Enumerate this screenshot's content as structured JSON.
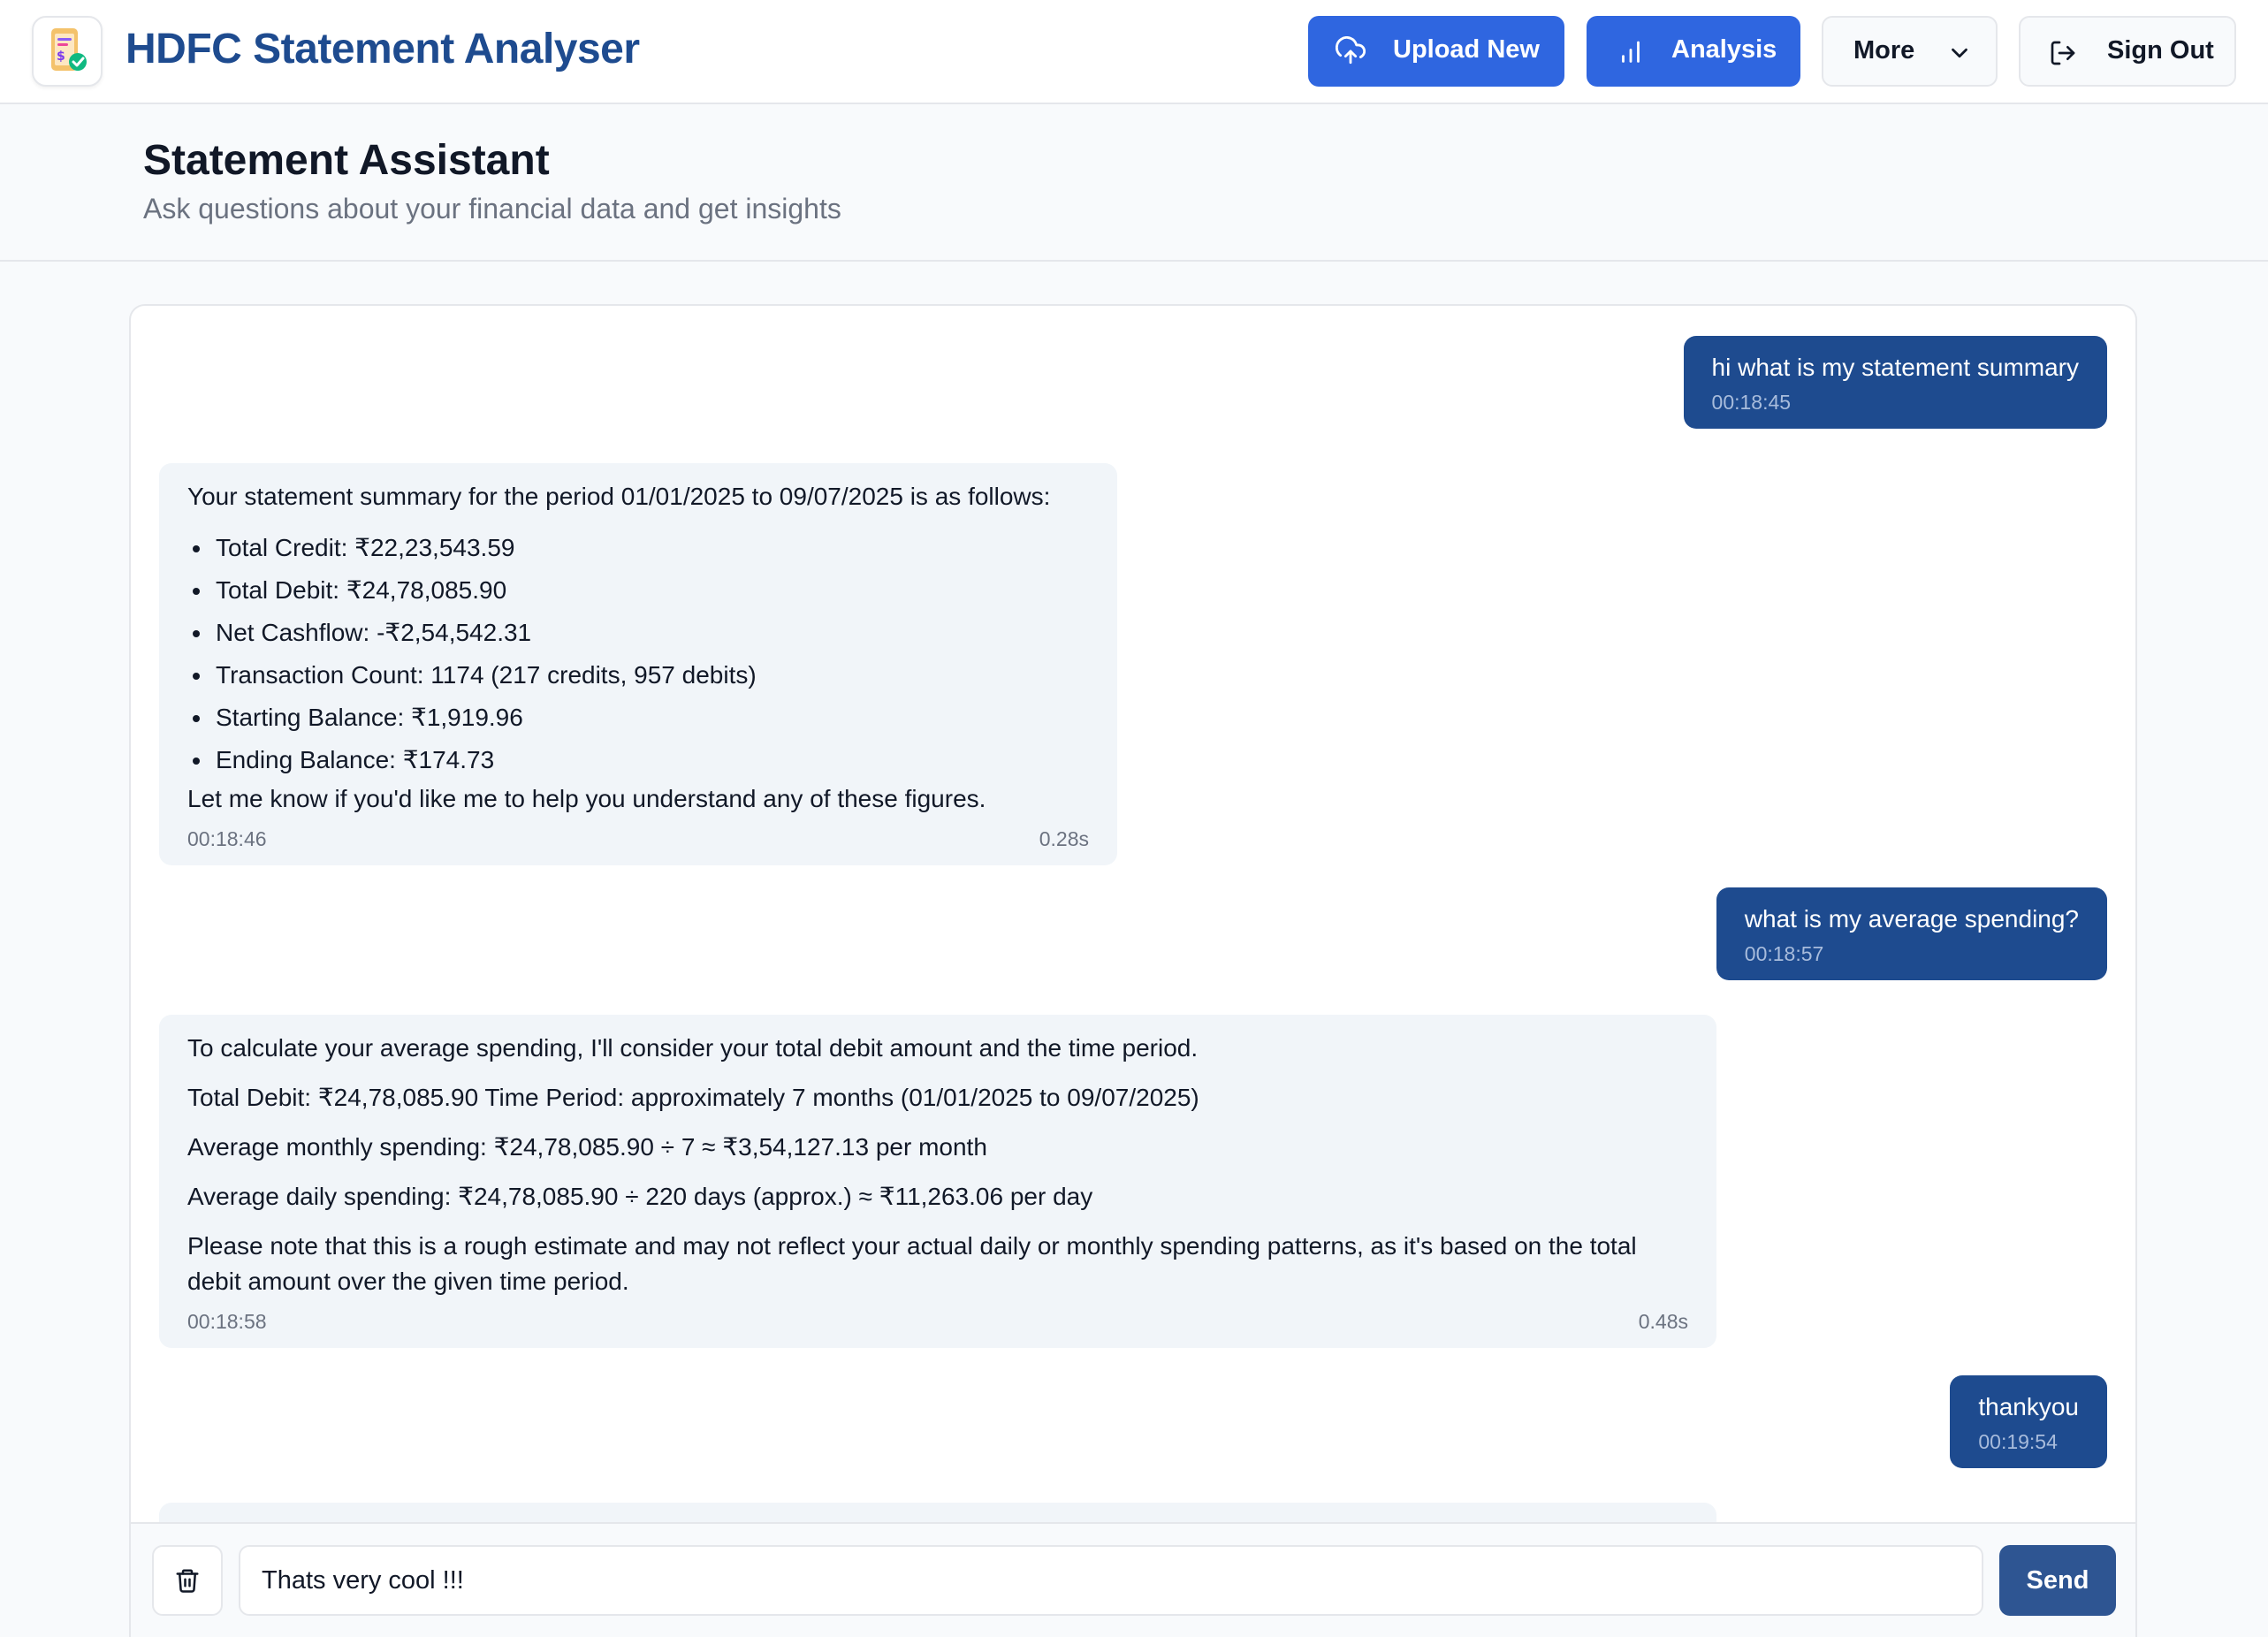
{
  "header": {
    "app_title": "HDFC Statement Analyser",
    "logo_icon": "statement-app-logo-icon",
    "buttons": {
      "upload": "Upload New",
      "analysis": "Analysis",
      "more": "More",
      "signout": "Sign Out"
    },
    "colors": {
      "primary": "#2f66e0",
      "brand": "#1e4b8f"
    }
  },
  "page": {
    "title": "Statement Assistant",
    "subtitle": "Ask questions about your financial data and get insights"
  },
  "chat": {
    "messages": [
      {
        "role": "user",
        "text": "hi what is my statement summary",
        "time": "00:18:45"
      },
      {
        "role": "assistant",
        "intro": "Your statement summary for the period 01/01/2025 to 09/07/2025 is as follows:",
        "items": [
          "Total Credit: ₹22,23,543.59",
          "Total Debit: ₹24,78,085.90",
          "Net Cashflow: -₹2,54,542.31",
          "Transaction Count: 1174 (217 credits, 957 debits)",
          "Starting Balance: ₹1,919.96",
          "Ending Balance: ₹174.73"
        ],
        "outro": "Let me know if you'd like me to help you understand any of these figures.",
        "time": "00:18:46",
        "duration": "0.28s"
      },
      {
        "role": "user",
        "text": "what is my average spending?",
        "time": "00:18:57"
      },
      {
        "role": "assistant",
        "paragraphs": [
          "To calculate your average spending, I'll consider your total debit amount and the time period.",
          "Total Debit: ₹24,78,085.90 Time Period: approximately 7 months (01/01/2025 to 09/07/2025)",
          "Average monthly spending: ₹24,78,085.90 ÷ 7 ≈ ₹3,54,127.13 per month",
          "Average daily spending: ₹24,78,085.90 ÷ 220 days (approx.) ≈ ₹11,263.06 per day",
          "Please note that this is a rough estimate and may not reflect your actual daily or monthly spending patterns, as it's based on the total debit amount over the given time period."
        ],
        "time": "00:18:58",
        "duration": "0.48s"
      },
      {
        "role": "user",
        "text": "thankyou",
        "time": "00:19:54"
      }
    ]
  },
  "composer": {
    "value": "Thats very cool !!!",
    "send_label": "Send"
  }
}
